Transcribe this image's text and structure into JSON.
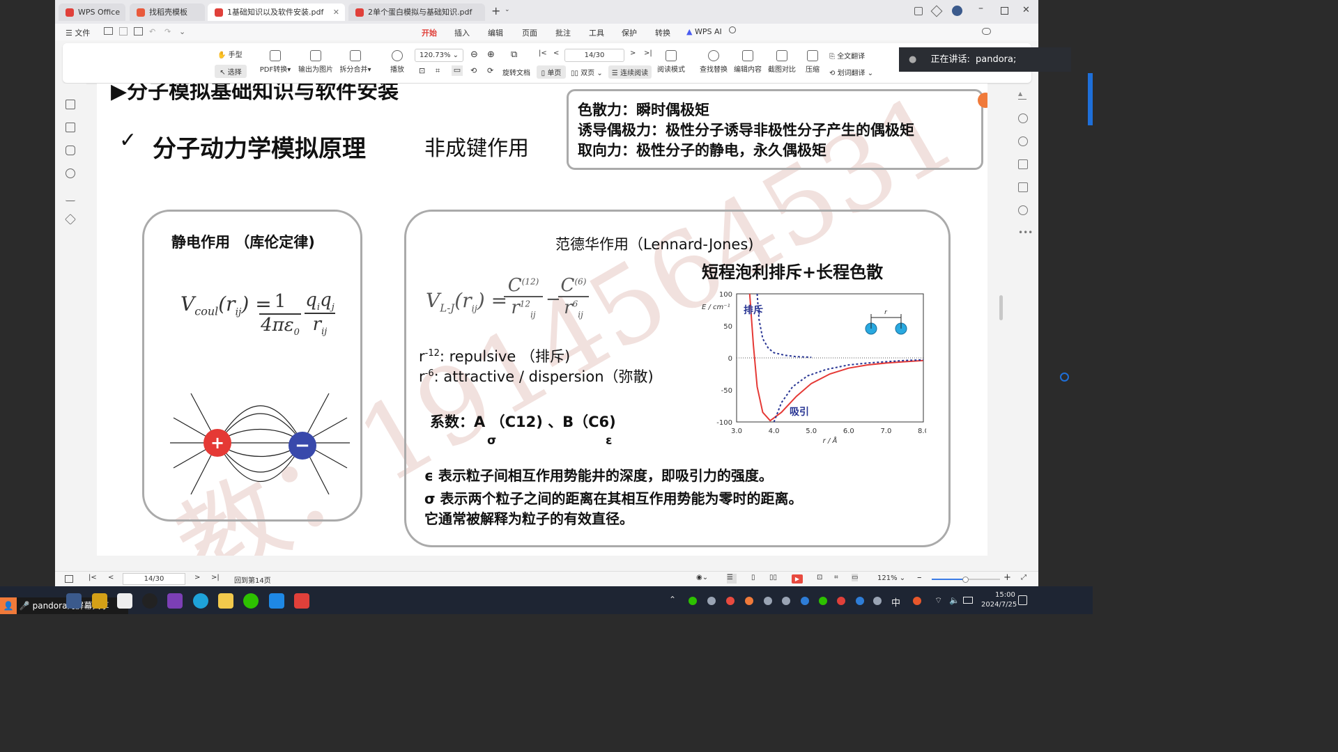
{
  "tabs": [
    {
      "label": "WPS Office"
    },
    {
      "label": "找稻壳模板"
    },
    {
      "label": "1基础知识以及软件安装.pdf"
    },
    {
      "label": "2单个蛋白模拟与基础知识.pdf"
    }
  ],
  "menubar": {
    "file": "文件",
    "items": [
      "开始",
      "插入",
      "编辑",
      "页面",
      "批注",
      "工具",
      "保护",
      "转换"
    ],
    "wps_ai": "WPS AI"
  },
  "toolbar": {
    "hand": "手型",
    "select": "选择",
    "pdf_convert": "PDF转换",
    "export_image": "输出为图片",
    "split_merge": "拆分合并",
    "play": "播放",
    "zoom": "120.73%",
    "page": "14/30",
    "rotate": "旋转文档",
    "single": "单页",
    "double": "双页",
    "continuous": "连续阅读",
    "reading": "阅读模式",
    "find_replace": "查找替换",
    "edit_content": "编辑内容",
    "screenshot_compare": "截图对比",
    "compress": "压缩",
    "full_translate": "全文翻译",
    "word_translate": "划词翻译"
  },
  "speaking": {
    "label": "正在讲话:",
    "name": "pandora;"
  },
  "slide": {
    "top_title": "分子模拟基础知识与软件安装",
    "check": "✓",
    "subtitle": "分子动力学模拟原理",
    "noncovalent": "非成键作用",
    "force_box": [
      "色散力：瞬时偶极矩",
      "诱导偶极力：极性分子诱导非极性分子产生的偶极矩",
      "取向力：极性分子的静电，永久偶极矩"
    ],
    "left_box_title": "静电作用 （库伦定律)",
    "coulomb": {
      "V": "V",
      "sub": "coul",
      "rij": "(r",
      "ij": "ij",
      ")": ")",
      "eq": "=",
      "one": "1",
      "den": "4πε",
      "zero": "0",
      "q": "q",
      "i": "i",
      "j": "j",
      "r": "r"
    },
    "right_box_title": "范德华作用（Lennard-Jones)",
    "short_long": "短程泡利排斥+长程色散",
    "lj": {
      "V": "V",
      "sub": "L-J",
      "c12": "C",
      "p12": "(12)",
      "c6": "C",
      "p6": "(6)",
      "r12": "12",
      "r6": "6",
      "r": "r",
      "ij": "ij"
    },
    "rep_prefix": "r",
    "rep_exp": "-12",
    "rep_text": ": repulsive （排斥)",
    "att_prefix": "r",
    "att_exp": "-6",
    "att_text": ": attractive / dispersion（弥散)",
    "coef": "系数：A （C12) 、B（C6)",
    "sigma": "σ",
    "eps": "ε",
    "desc1": "ϵ 表示粒子间相互作用势能井的深度，即吸引力的强度。",
    "desc2": "σ 表示两个粒子之间的距离在其相互作用势能为零时的距离。",
    "desc3": "它通常被解释为粒子的有效直径。",
    "watermark": "教：1914564531"
  },
  "chart_data": {
    "type": "line",
    "title": "",
    "xlabel": "r / Å",
    "ylabel": "E / cm⁻¹",
    "xlim": [
      3.0,
      8.0
    ],
    "ylim": [
      -100,
      100
    ],
    "xticks": [
      "3.0",
      "4.0",
      "5.0",
      "6.0",
      "7.0",
      "8.0"
    ],
    "yticks": [
      "100",
      "50",
      "0",
      "-50",
      "-100"
    ],
    "annotations": [
      "排斥",
      "吸引",
      "r"
    ],
    "series": [
      {
        "style": "solid",
        "color": "#e53935",
        "x": [
          3.35,
          3.45,
          3.55,
          3.7,
          3.9,
          4.2,
          4.6,
          5.0,
          5.5,
          6.0,
          6.5,
          7.0,
          7.5,
          8.0
        ],
        "values": [
          100,
          20,
          -45,
          -85,
          -98,
          -85,
          -60,
          -40,
          -25,
          -16,
          -11,
          -8,
          -6,
          -4
        ]
      },
      {
        "style": "dashed",
        "color": "#283593",
        "x": [
          3.55,
          3.6,
          3.7,
          3.85,
          4.0,
          4.3,
          4.6,
          5.0
        ],
        "values": [
          100,
          60,
          30,
          15,
          8,
          4,
          2,
          1
        ]
      },
      {
        "style": "dashed",
        "color": "#283593",
        "x": [
          4.0,
          4.2,
          4.5,
          4.9,
          5.4,
          6.0,
          6.5,
          7.0,
          7.5,
          8.0
        ],
        "values": [
          -100,
          -70,
          -45,
          -28,
          -18,
          -11,
          -8,
          -6,
          -4,
          -3
        ]
      }
    ]
  },
  "status": {
    "page": "14/30",
    "back": "回到第14页",
    "zoom": "121%"
  },
  "taskbar": {
    "share_label": "pandora的屏幕共享",
    "ime": "中",
    "time": "15:00",
    "date": "2024/7/25"
  }
}
